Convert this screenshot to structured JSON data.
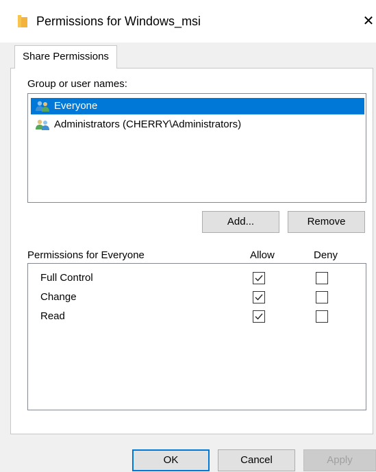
{
  "window": {
    "title": "Permissions for Windows_msi",
    "close_glyph": "✕",
    "folder_icon_color": "#f8c44f"
  },
  "tabs": [
    {
      "label": "Share Permissions",
      "active": true
    }
  ],
  "groups": {
    "label": "Group or user names:",
    "items": [
      {
        "name": "Everyone",
        "icon": "users-icon",
        "selected": true
      },
      {
        "name": "Administrators (CHERRY\\Administrators)",
        "icon": "users-icon",
        "selected": false
      }
    ],
    "add_label": "Add...",
    "remove_label": "Remove"
  },
  "permissions": {
    "label": "Permissions for Everyone",
    "allow_label": "Allow",
    "deny_label": "Deny",
    "rows": [
      {
        "name": "Full Control",
        "allow": true,
        "deny": false
      },
      {
        "name": "Change",
        "allow": true,
        "deny": false
      },
      {
        "name": "Read",
        "allow": true,
        "deny": false
      }
    ]
  },
  "footer": {
    "ok_label": "OK",
    "cancel_label": "Cancel",
    "apply_label": "Apply",
    "apply_enabled": false
  },
  "colors": {
    "selection": "#0078d7",
    "dialog_bg": "#f0f0f0"
  }
}
